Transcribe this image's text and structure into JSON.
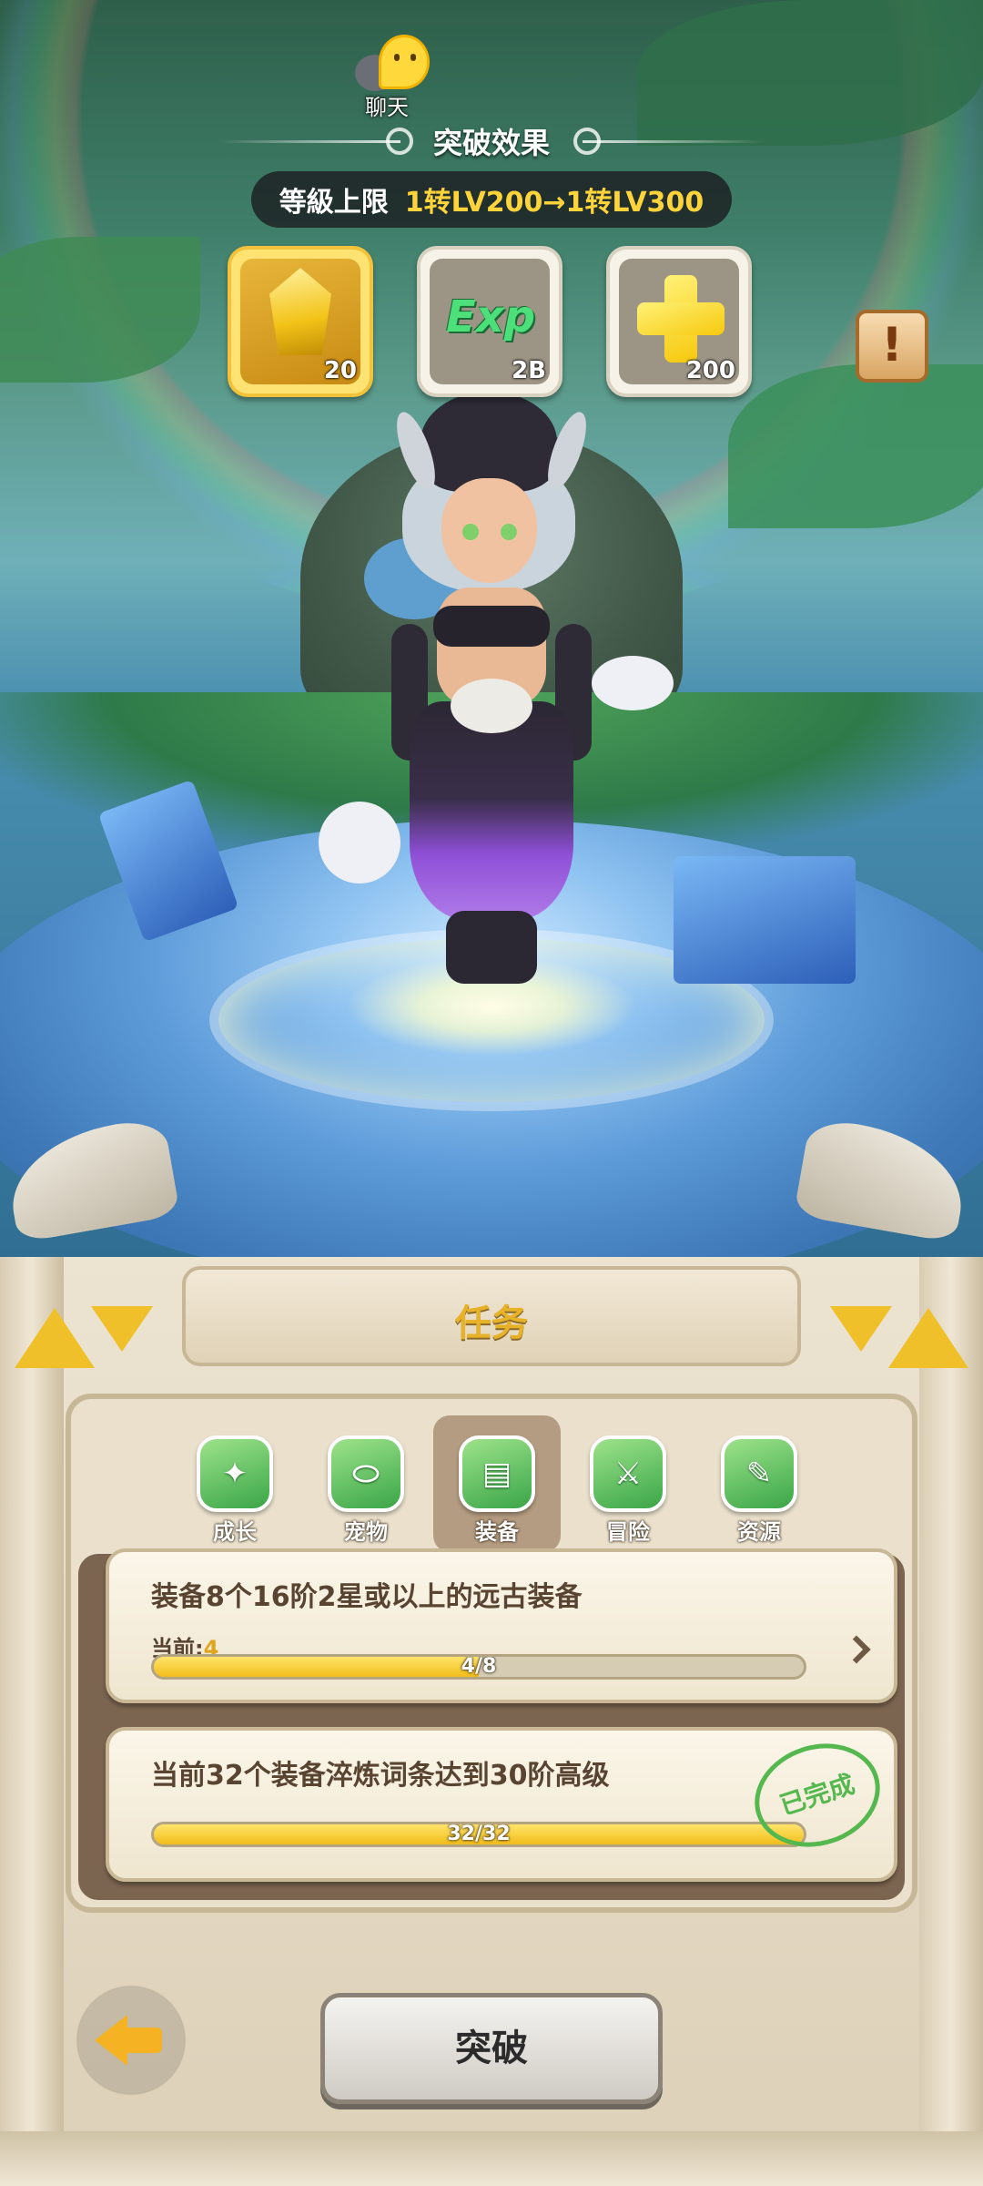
{
  "hud": {
    "chat_label": "聊天",
    "effect_title": "突破效果",
    "level_cap_label": "等級上限",
    "level_cap_value": "1转LV200→1转LV300"
  },
  "rewards": [
    {
      "icon": "gold-crystal-icon",
      "quantity": "20"
    },
    {
      "icon": "exp-icon",
      "icon_text": "Exp",
      "quantity": "2B"
    },
    {
      "icon": "gold-cross-icon",
      "quantity": "200"
    }
  ],
  "info_button": {
    "icon": "exclamation-scroll-icon",
    "glyph": "!"
  },
  "panel": {
    "title": "任务",
    "tabs": [
      {
        "label": "成长",
        "icon": "growth-icon",
        "glyph": "✦",
        "active": false
      },
      {
        "label": "宠物",
        "icon": "pet-icon",
        "glyph": "⬭",
        "active": false
      },
      {
        "label": "装备",
        "icon": "equipment-icon",
        "glyph": "▤",
        "active": true
      },
      {
        "label": "冒险",
        "icon": "adventure-icon",
        "glyph": "⚔",
        "active": false
      },
      {
        "label": "资源",
        "icon": "bone-icon",
        "glyph": "✎",
        "active": false
      }
    ],
    "tasks": [
      {
        "description": "装备8个16阶2星或以上的远古装备",
        "current_label": "当前:",
        "current_value": "4",
        "progress_text": "4/8",
        "progress": 0.5,
        "completed": false
      },
      {
        "description": "当前32个装备淬炼词条达到30阶高级",
        "progress_text": "32/32",
        "progress": 1.0,
        "completed": true,
        "stamp_text": "已完成"
      }
    ],
    "break_button": "突破",
    "back_icon": "back-arrow-icon"
  },
  "colors": {
    "accent_gold": "#f0c02a",
    "level_value": "#ffd43b",
    "completed_green": "#55b84f",
    "progress_fill": "#f2bd1a"
  }
}
